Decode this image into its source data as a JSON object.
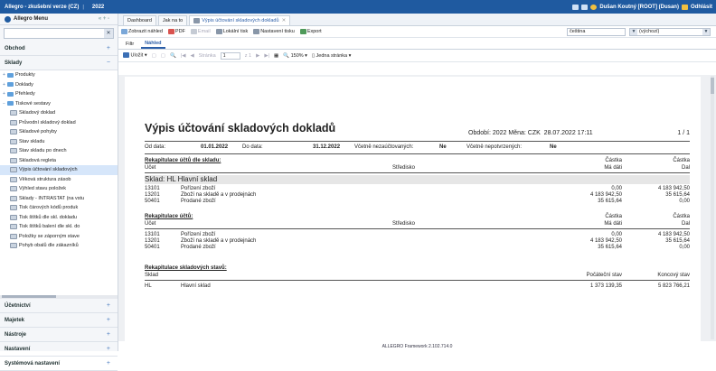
{
  "topbar": {
    "title": "Allegro - zkušební verze (CZ)",
    "year": "2022",
    "user": "Dušan Koutný [ROOT] (Dusan)",
    "logout": "Odhlásit"
  },
  "sidebar": {
    "header": "Allegro Menu",
    "controls": "« + -",
    "sections_top": [
      {
        "label": "Obchod"
      },
      {
        "label": "Sklady"
      }
    ],
    "tree": [
      {
        "label": "Produkty",
        "type": "folder",
        "indent": 0
      },
      {
        "label": "Doklady",
        "type": "folder",
        "indent": 0
      },
      {
        "label": "Přehledy",
        "type": "folder",
        "indent": 0
      },
      {
        "label": "Tiskové sestavy",
        "type": "folder",
        "indent": 0,
        "open": true
      },
      {
        "label": "Skladový doklad",
        "type": "doc",
        "indent": 1
      },
      {
        "label": "Průvodní skladový doklad",
        "type": "doc",
        "indent": 1
      },
      {
        "label": "Skladové pohyby",
        "type": "doc",
        "indent": 1
      },
      {
        "label": "Stav skladu",
        "type": "doc",
        "indent": 1
      },
      {
        "label": "Stav skladu po dnech",
        "type": "doc",
        "indent": 1
      },
      {
        "label": "Skladová regleta",
        "type": "doc",
        "indent": 1
      },
      {
        "label": "Výpis účtování skladových",
        "type": "doc",
        "indent": 1,
        "selected": true
      },
      {
        "label": "Věková struktura zásob",
        "type": "doc",
        "indent": 1
      },
      {
        "label": "Výhled stavu položek",
        "type": "doc",
        "indent": 1
      },
      {
        "label": "Sklady - INTRASTAT (na vstu",
        "type": "doc",
        "indent": 1
      },
      {
        "label": "Tisk čárových kódů produk",
        "type": "doc",
        "indent": 1
      },
      {
        "label": "Tisk štítků dle skl. dokladu",
        "type": "doc",
        "indent": 1
      },
      {
        "label": "Tisk štítků balení dle skl. do",
        "type": "doc",
        "indent": 1
      },
      {
        "label": "Položky se záporným stave",
        "type": "doc",
        "indent": 1
      },
      {
        "label": "Pohyb obalů dle zákazníků",
        "type": "doc",
        "indent": 1
      }
    ],
    "sections_bottom": [
      {
        "label": "Účetnictví"
      },
      {
        "label": "Majetek"
      },
      {
        "label": "Nástroje"
      },
      {
        "label": "Nastavení"
      },
      {
        "label": "Systémová nastavení"
      }
    ]
  },
  "tabs": [
    {
      "label": "Dashboard"
    },
    {
      "label": "Jak na to"
    },
    {
      "label": "Výpis účtování skladových dokladů",
      "active": true
    }
  ],
  "toolbar": {
    "preview": "Zobrazit náhled",
    "pdf": "PDF",
    "email": "Email",
    "local_print": "Lokální tisk",
    "print_settings": "Nastavení tisku",
    "export": "Export",
    "language": "čeština",
    "variant": "(výchozí)"
  },
  "subtabs": [
    {
      "label": "Filtr"
    },
    {
      "label": "Náhled",
      "active": true
    }
  ],
  "report_toolbar": {
    "save": "Uložit",
    "page_label": "Stránka",
    "page": "1",
    "of": "z 1",
    "zoom": "150%",
    "view": "Jedna stránka"
  },
  "report": {
    "title": "Výpis účtování skladových dokladů",
    "period": "Období: 2022 Měna: CZK",
    "printed": "28.07.2022 17:11",
    "page": "1 / 1",
    "filter": {
      "from_label": "Od data:",
      "from": "01.01.2022",
      "to_label": "Do data:",
      "to": "31.12.2022",
      "unposted_label": "Včetně nezaúčtovaných:",
      "unposted": "Ne",
      "unconfirmed_label": "Včetně nepotvrzených:",
      "unconfirmed": "Ne"
    },
    "sec1": {
      "title": "Rekapitulace účtů dle skladu:",
      "col_account": "Účet",
      "col_center": "Středisko",
      "col_amount": "Částka",
      "col_amount2": "Částka",
      "col_md": "Má dáti",
      "col_d": "Dal"
    },
    "warehouse": "Sklad: HL Hlavní sklad",
    "rows1": [
      {
        "acc": "13101",
        "name": "Pořízení zboží",
        "md": "0,00",
        "d": "4 183 942,50"
      },
      {
        "acc": "13201",
        "name": "Zboží na skladě a v prodejnách",
        "md": "4 183 942,50",
        "d": "35 615,64"
      },
      {
        "acc": "50401",
        "name": "Prodané zboží",
        "md": "35 615,64",
        "d": "0,00"
      }
    ],
    "sec2": {
      "title": "Rekapitulace účtů:",
      "col_account": "Účet",
      "col_center": "Středisko",
      "col_amount": "Částka",
      "col_amount2": "Částka",
      "col_md": "Má dáti",
      "col_d": "Dal"
    },
    "rows2": [
      {
        "acc": "13101",
        "name": "Pořízení zboží",
        "md": "0,00",
        "d": "4 183 942,50"
      },
      {
        "acc": "13201",
        "name": "Zboží na skladě a v prodejnách",
        "md": "4 183 942,50",
        "d": "35 615,64"
      },
      {
        "acc": "50401",
        "name": "Prodané zboží",
        "md": "35 615,64",
        "d": "0,00"
      }
    ],
    "sec3": {
      "title": "Rekapitulace skladových stavů:",
      "col_store": "Sklad",
      "col_start": "Počáteční stav",
      "col_end": "Koncový stav"
    },
    "rows3": [
      {
        "store": "HL",
        "name": "Hlavní sklad",
        "start": "1 373 139,35",
        "end": "5 823 766,21"
      }
    ]
  },
  "footer": "ALLEGRO Framework 2.102.714.0"
}
